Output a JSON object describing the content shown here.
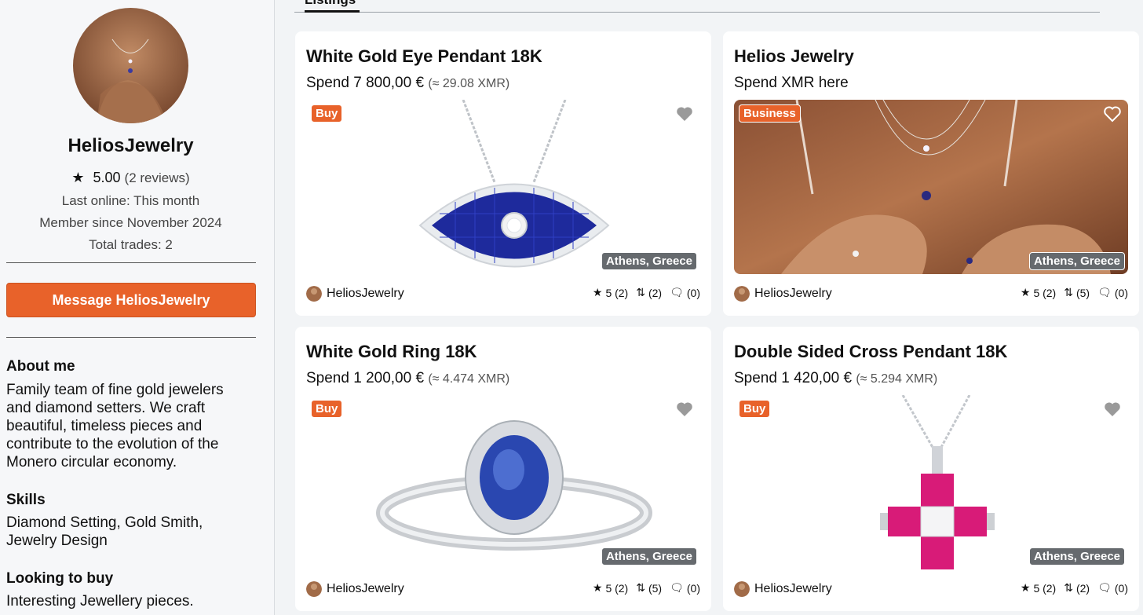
{
  "profile": {
    "name": "HeliosJewelry",
    "rating": "5.00",
    "reviews": "(2 reviews)",
    "last_online": "Last online: This month",
    "member_since": "Member since November 2024",
    "total_trades": "Total trades: 2",
    "message_button": "Message HeliosJewelry"
  },
  "about": {
    "heading": "About me",
    "text": "Family team of fine gold jewelers and diamond setters. We craft beautiful, timeless pieces and contribute to the evolution of the Monero circular economy."
  },
  "skills": {
    "heading": "Skills",
    "text": "Diamond Setting, Gold Smith, Jewelry Design"
  },
  "looking": {
    "heading": "Looking to buy",
    "text": "Interesting Jewellery pieces."
  },
  "tabs": {
    "active": "Listings"
  },
  "listings": [
    {
      "title": "White Gold Eye Pendant 18K",
      "price": "Spend 7 800,00 €",
      "xmr": "(≈ 29.08 XMR)",
      "badge": "Buy",
      "location": "Athens, Greece",
      "seller": "HeliosJewelry",
      "rating": "5 (2)",
      "trades": "(2)",
      "comments": "(0)"
    },
    {
      "title": "Helios Jewelry",
      "price": "Spend XMR here",
      "xmr": "",
      "badge": "Business",
      "location": "Athens, Greece",
      "seller": "HeliosJewelry",
      "rating": "5 (2)",
      "trades": "(5)",
      "comments": "(0)"
    },
    {
      "title": "White Gold Ring 18K",
      "price": "Spend 1 200,00 €",
      "xmr": "(≈ 4.474 XMR)",
      "badge": "Buy",
      "location": "Athens, Greece",
      "seller": "HeliosJewelry",
      "rating": "5 (2)",
      "trades": "(5)",
      "comments": "(0)"
    },
    {
      "title": "Double Sided Cross Pendant 18K",
      "price": "Spend 1 420,00 €",
      "xmr": "(≈ 5.294 XMR)",
      "badge": "Buy",
      "location": "Athens, Greece",
      "seller": "HeliosJewelry",
      "rating": "5 (2)",
      "trades": "(2)",
      "comments": "(0)"
    }
  ],
  "colors": {
    "accent": "#e8622a",
    "location_badge": "#666a6e"
  },
  "icons": [
    "star-icon",
    "trades-arrows-icon",
    "comment-icon",
    "heart-icon"
  ]
}
